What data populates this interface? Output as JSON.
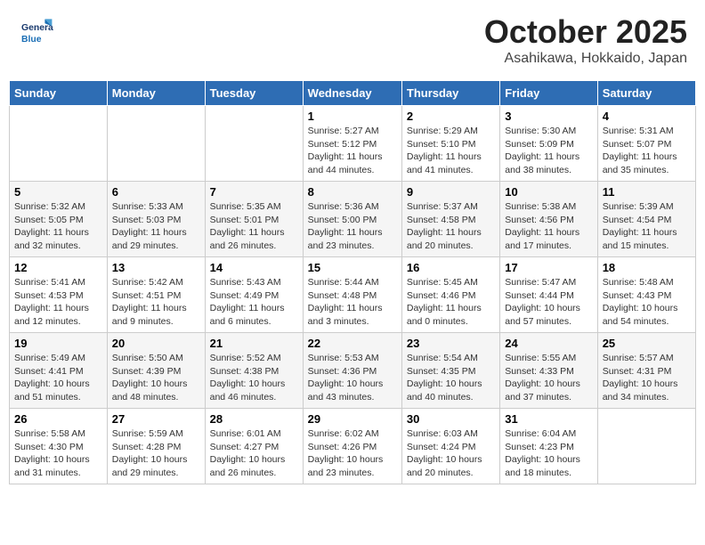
{
  "header": {
    "logo_general": "General",
    "logo_blue": "Blue",
    "month_title": "October 2025",
    "location": "Asahikawa, Hokkaido, Japan"
  },
  "weekdays": [
    "Sunday",
    "Monday",
    "Tuesday",
    "Wednesday",
    "Thursday",
    "Friday",
    "Saturday"
  ],
  "weeks": [
    [
      {
        "day": "",
        "info": ""
      },
      {
        "day": "",
        "info": ""
      },
      {
        "day": "",
        "info": ""
      },
      {
        "day": "1",
        "info": "Sunrise: 5:27 AM\nSunset: 5:12 PM\nDaylight: 11 hours\nand 44 minutes."
      },
      {
        "day": "2",
        "info": "Sunrise: 5:29 AM\nSunset: 5:10 PM\nDaylight: 11 hours\nand 41 minutes."
      },
      {
        "day": "3",
        "info": "Sunrise: 5:30 AM\nSunset: 5:09 PM\nDaylight: 11 hours\nand 38 minutes."
      },
      {
        "day": "4",
        "info": "Sunrise: 5:31 AM\nSunset: 5:07 PM\nDaylight: 11 hours\nand 35 minutes."
      }
    ],
    [
      {
        "day": "5",
        "info": "Sunrise: 5:32 AM\nSunset: 5:05 PM\nDaylight: 11 hours\nand 32 minutes."
      },
      {
        "day": "6",
        "info": "Sunrise: 5:33 AM\nSunset: 5:03 PM\nDaylight: 11 hours\nand 29 minutes."
      },
      {
        "day": "7",
        "info": "Sunrise: 5:35 AM\nSunset: 5:01 PM\nDaylight: 11 hours\nand 26 minutes."
      },
      {
        "day": "8",
        "info": "Sunrise: 5:36 AM\nSunset: 5:00 PM\nDaylight: 11 hours\nand 23 minutes."
      },
      {
        "day": "9",
        "info": "Sunrise: 5:37 AM\nSunset: 4:58 PM\nDaylight: 11 hours\nand 20 minutes."
      },
      {
        "day": "10",
        "info": "Sunrise: 5:38 AM\nSunset: 4:56 PM\nDaylight: 11 hours\nand 17 minutes."
      },
      {
        "day": "11",
        "info": "Sunrise: 5:39 AM\nSunset: 4:54 PM\nDaylight: 11 hours\nand 15 minutes."
      }
    ],
    [
      {
        "day": "12",
        "info": "Sunrise: 5:41 AM\nSunset: 4:53 PM\nDaylight: 11 hours\nand 12 minutes."
      },
      {
        "day": "13",
        "info": "Sunrise: 5:42 AM\nSunset: 4:51 PM\nDaylight: 11 hours\nand 9 minutes."
      },
      {
        "day": "14",
        "info": "Sunrise: 5:43 AM\nSunset: 4:49 PM\nDaylight: 11 hours\nand 6 minutes."
      },
      {
        "day": "15",
        "info": "Sunrise: 5:44 AM\nSunset: 4:48 PM\nDaylight: 11 hours\nand 3 minutes."
      },
      {
        "day": "16",
        "info": "Sunrise: 5:45 AM\nSunset: 4:46 PM\nDaylight: 11 hours\nand 0 minutes."
      },
      {
        "day": "17",
        "info": "Sunrise: 5:47 AM\nSunset: 4:44 PM\nDaylight: 10 hours\nand 57 minutes."
      },
      {
        "day": "18",
        "info": "Sunrise: 5:48 AM\nSunset: 4:43 PM\nDaylight: 10 hours\nand 54 minutes."
      }
    ],
    [
      {
        "day": "19",
        "info": "Sunrise: 5:49 AM\nSunset: 4:41 PM\nDaylight: 10 hours\nand 51 minutes."
      },
      {
        "day": "20",
        "info": "Sunrise: 5:50 AM\nSunset: 4:39 PM\nDaylight: 10 hours\nand 48 minutes."
      },
      {
        "day": "21",
        "info": "Sunrise: 5:52 AM\nSunset: 4:38 PM\nDaylight: 10 hours\nand 46 minutes."
      },
      {
        "day": "22",
        "info": "Sunrise: 5:53 AM\nSunset: 4:36 PM\nDaylight: 10 hours\nand 43 minutes."
      },
      {
        "day": "23",
        "info": "Sunrise: 5:54 AM\nSunset: 4:35 PM\nDaylight: 10 hours\nand 40 minutes."
      },
      {
        "day": "24",
        "info": "Sunrise: 5:55 AM\nSunset: 4:33 PM\nDaylight: 10 hours\nand 37 minutes."
      },
      {
        "day": "25",
        "info": "Sunrise: 5:57 AM\nSunset: 4:31 PM\nDaylight: 10 hours\nand 34 minutes."
      }
    ],
    [
      {
        "day": "26",
        "info": "Sunrise: 5:58 AM\nSunset: 4:30 PM\nDaylight: 10 hours\nand 31 minutes."
      },
      {
        "day": "27",
        "info": "Sunrise: 5:59 AM\nSunset: 4:28 PM\nDaylight: 10 hours\nand 29 minutes."
      },
      {
        "day": "28",
        "info": "Sunrise: 6:01 AM\nSunset: 4:27 PM\nDaylight: 10 hours\nand 26 minutes."
      },
      {
        "day": "29",
        "info": "Sunrise: 6:02 AM\nSunset: 4:26 PM\nDaylight: 10 hours\nand 23 minutes."
      },
      {
        "day": "30",
        "info": "Sunrise: 6:03 AM\nSunset: 4:24 PM\nDaylight: 10 hours\nand 20 minutes."
      },
      {
        "day": "31",
        "info": "Sunrise: 6:04 AM\nSunset: 4:23 PM\nDaylight: 10 hours\nand 18 minutes."
      },
      {
        "day": "",
        "info": ""
      }
    ]
  ]
}
